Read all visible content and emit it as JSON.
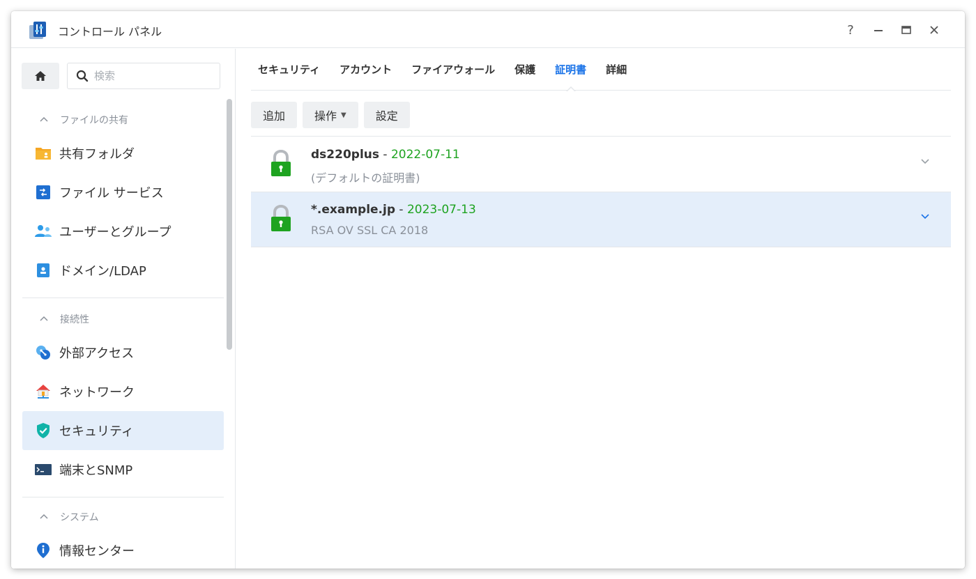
{
  "window": {
    "title": "コントロール パネル",
    "controls": {
      "help": "?",
      "minimize": "—",
      "maximize": "▭",
      "close": "✕"
    }
  },
  "sidebar": {
    "search_placeholder": "検索",
    "sections": [
      {
        "label": "ファイルの共有",
        "items": [
          {
            "label": "共有フォルダ",
            "icon": "folder-icon"
          },
          {
            "label": "ファイル サービス",
            "icon": "file-services-icon"
          },
          {
            "label": "ユーザーとグループ",
            "icon": "users-icon"
          },
          {
            "label": "ドメイン/LDAP",
            "icon": "domain-icon"
          }
        ]
      },
      {
        "label": "接続性",
        "items": [
          {
            "label": "外部アクセス",
            "icon": "external-access-icon"
          },
          {
            "label": "ネットワーク",
            "icon": "network-icon"
          },
          {
            "label": "セキュリティ",
            "icon": "shield-icon",
            "active": true
          },
          {
            "label": "端末とSNMP",
            "icon": "terminal-icon"
          }
        ]
      },
      {
        "label": "システム",
        "items": [
          {
            "label": "情報センター",
            "icon": "info-icon"
          }
        ]
      }
    ]
  },
  "tabs": [
    {
      "label": "セキュリティ"
    },
    {
      "label": "アカウント"
    },
    {
      "label": "ファイアウォール"
    },
    {
      "label": "保護"
    },
    {
      "label": "証明書",
      "active": true
    },
    {
      "label": "詳細"
    }
  ],
  "toolbar": {
    "add": "追加",
    "action": "操作",
    "settings": "設定"
  },
  "certificates": [
    {
      "name": "ds220plus",
      "separator": " - ",
      "date": "2022-07-11",
      "subtitle": "(デフォルトの証明書)"
    },
    {
      "name": "*.example.jp",
      "separator": " - ",
      "date": "2023-07-13",
      "subtitle": "RSA OV SSL CA 2018",
      "selected": true
    }
  ],
  "colors": {
    "accent": "#1a73e8",
    "lock_green": "#1ea320",
    "selected_bg": "#e4eefa"
  }
}
